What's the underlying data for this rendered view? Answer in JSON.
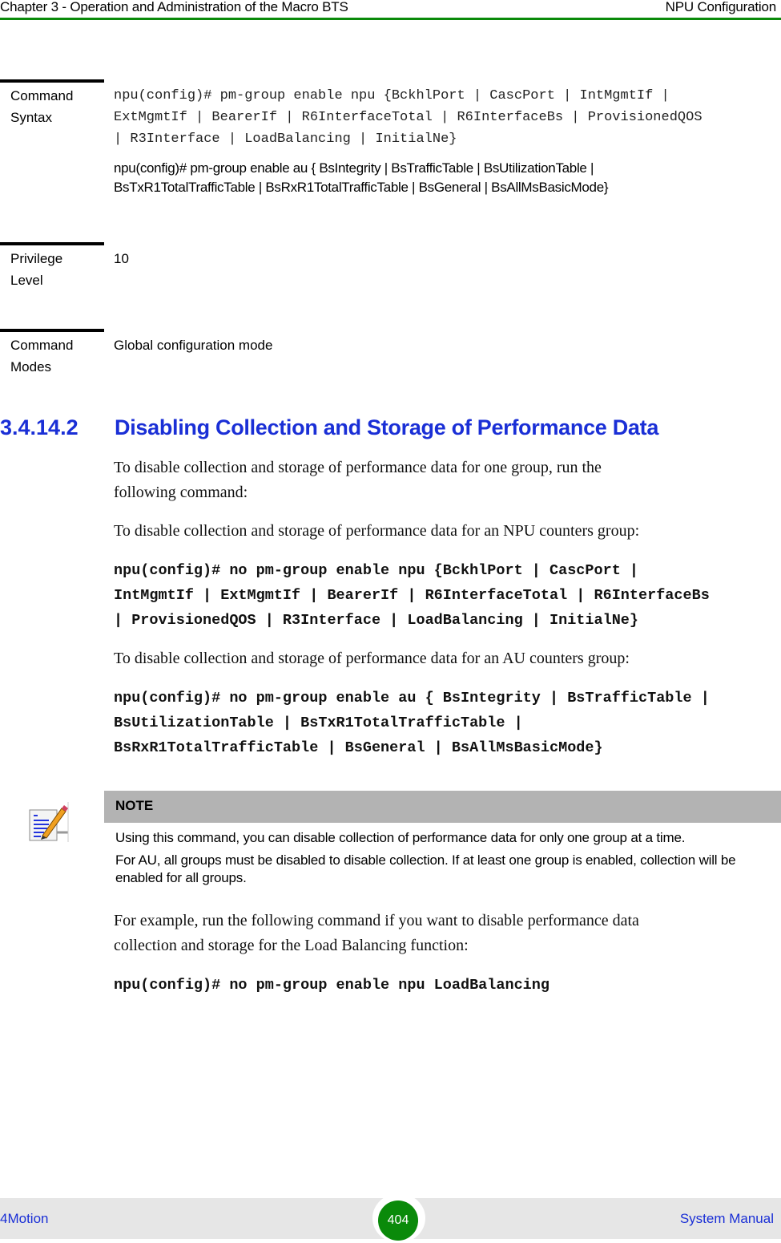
{
  "header": {
    "chapter": "Chapter 3 - Operation and Administration of the Macro BTS",
    "section": "NPU Configuration"
  },
  "command_table": {
    "syntax": {
      "label_line1": "Command",
      "label_line2": "Syntax",
      "npu_lines": [
        "npu(config)# pm-group enable npu {BckhlPort | CascPort | IntMgmtIf |",
        "ExtMgmtIf | BearerIf | R6InterfaceTotal | R6InterfaceBs | ProvisionedQOS",
        "| R3Interface | LoadBalancing | InitialNe}"
      ],
      "au_lines": [
        "npu(config)# pm-group enable au { BsIntegrity | BsTrafficTable | BsUtilizationTable |",
        "BsTxR1TotalTrafficTable | BsRxR1TotalTrafficTable | BsGeneral | BsAllMsBasicMode}"
      ]
    },
    "privilege": {
      "label_line1": "Privilege",
      "label_line2": "Level",
      "value": "10"
    },
    "modes": {
      "label_line1": "Command",
      "label_line2": "Modes",
      "value": "Global configuration mode"
    }
  },
  "section": {
    "number": "3.4.14.2",
    "title": "Disabling Collection and Storage of Performance Data"
  },
  "body": {
    "intro_lines": [
      "To disable collection and storage of performance data for one group, run the",
      "following command:"
    ],
    "npu_intro": "To disable collection and storage of performance data for an NPU counters group:",
    "npu_command_lines": [
      "npu(config)# no pm-group enable npu {BckhlPort | CascPort |",
      "IntMgmtIf | ExtMgmtIf | BearerIf | R6InterfaceTotal | R6InterfaceBs",
      "| ProvisionedQOS | R3Interface | LoadBalancing | InitialNe}"
    ],
    "au_intro": "To disable collection and storage of performance data for an AU counters group:",
    "au_command_lines": [
      "npu(config)# no pm-group enable au { BsIntegrity | BsTrafficTable |",
      "BsUtilizationTable | BsTxR1TotalTrafficTable |",
      "BsRxR1TotalTrafficTable | BsGeneral | BsAllMsBasicMode}"
    ],
    "example_lines": [
      "For example, run the following command if you want to disable performance data",
      "collection and storage for the Load Balancing function:"
    ],
    "example_command": "npu(config)# no pm-group enable npu LoadBalancing"
  },
  "note": {
    "icon": "note-pencil-icon",
    "title": "NOTE",
    "paragraph1": "Using this command, you can disable collection of performance data for only one group at a time.",
    "paragraph2": "For AU, all groups must be disabled to disable collection. If at least one group is enabled, collection will be enabled for all groups."
  },
  "footer": {
    "product": "4Motion",
    "page_number": "404",
    "document": "System Manual"
  },
  "colors": {
    "accent_green": "#0a8a0a",
    "heading_blue": "#1a2fd6",
    "note_bar": "#b3b3b3",
    "footer_bg": "#e6e6e6"
  }
}
